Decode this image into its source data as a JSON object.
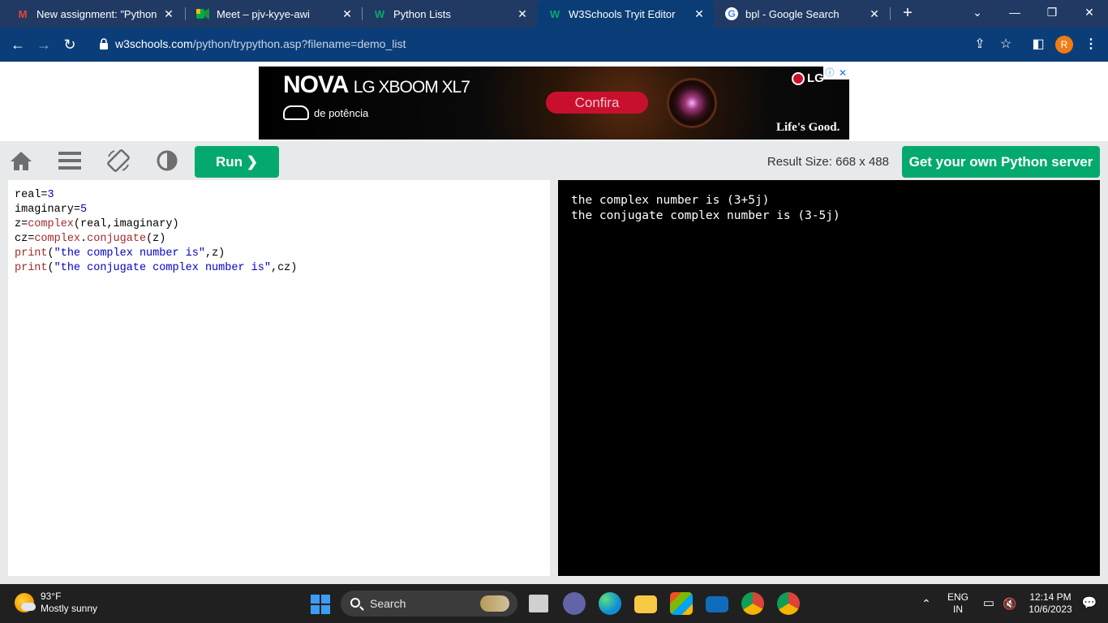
{
  "browser": {
    "tabs": [
      {
        "title": "New assignment: \"Python fi",
        "favicon": "gmail-icon",
        "active": false
      },
      {
        "title": "Meet – pjv-kyye-awi",
        "favicon": "meet-icon",
        "active": false
      },
      {
        "title": "Python Lists",
        "favicon": "w3schools-icon",
        "active": false
      },
      {
        "title": "W3Schools Tryit Editor",
        "favicon": "w3schools-icon",
        "active": true
      },
      {
        "title": "bpl - Google Search",
        "favicon": "google-icon",
        "active": false
      }
    ],
    "url_host": "w3schools.com",
    "url_path": "/python/trypython.asp?filename=demo_list",
    "profile_initial": "R"
  },
  "ad": {
    "headline": "NOVA",
    "product": "LG XBOOM XL7",
    "subline": "de potência",
    "cta": "Confira",
    "brand": "LG",
    "slogan": "Life's Good."
  },
  "tryit": {
    "run_label": "Run ❯",
    "result_size": "Result Size: 668 x 488",
    "get_server_label": "Get your own Python server",
    "code_lines": [
      "real=3",
      "imaginary=5",
      "z=complex(real,imaginary)",
      "cz=complex.conjugate(z)",
      "print(\"the complex number is\",z)",
      "print(\"the conjugate complex number is\",cz)"
    ],
    "output_lines": [
      "the complex number is (3+5j)",
      "the conjugate complex number is (3-5j)"
    ]
  },
  "taskbar": {
    "temperature": "93°F",
    "condition": "Mostly sunny",
    "search_label": "Search",
    "lang_top": "ENG",
    "lang_bottom": "IN",
    "time": "12:14 PM",
    "date": "10/6/2023"
  },
  "colors": {
    "accent_green": "#04aa6d",
    "chrome_dark": "#0b3e78",
    "result_bg": "#000000"
  }
}
